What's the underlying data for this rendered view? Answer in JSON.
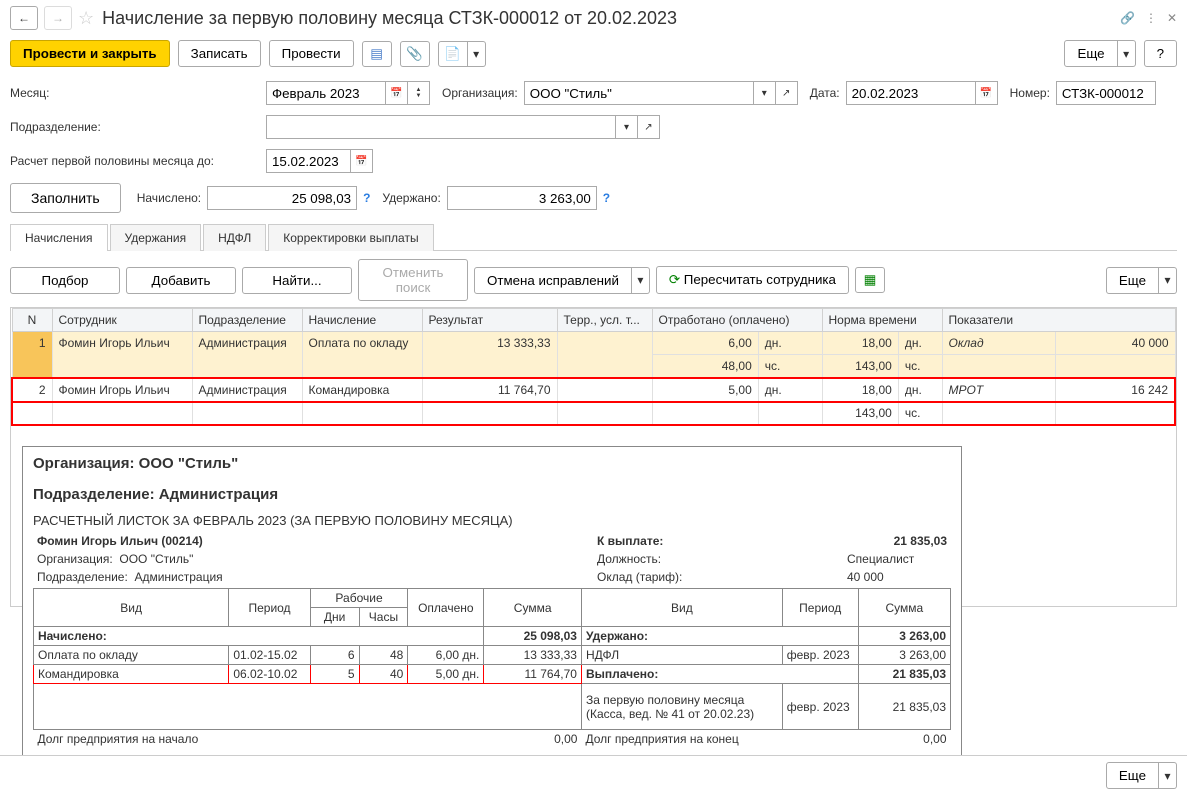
{
  "header": {
    "title": "Начисление за первую половину месяца СТЗК-000012 от 20.02.2023"
  },
  "toolbar": {
    "submit_close": "Провести и закрыть",
    "write": "Записать",
    "submit": "Провести",
    "more": "Еще",
    "help": "?"
  },
  "form": {
    "month_label": "Месяц:",
    "month_value": "Февраль 2023",
    "org_label": "Организация:",
    "org_value": "ООО \"Стиль\"",
    "date_label": "Дата:",
    "date_value": "20.02.2023",
    "number_label": "Номер:",
    "number_value": "СТЗК-000012",
    "dept_label": "Подразделение:",
    "dept_value": "",
    "calc_label": "Расчет первой половины месяца до:",
    "calc_value": "15.02.2023",
    "fill_btn": "Заполнить",
    "accrued_label": "Начислено:",
    "accrued_value": "25 098,03",
    "withheld_label": "Удержано:",
    "withheld_value": "3 263,00"
  },
  "tabs": {
    "t1": "Начисления",
    "t2": "Удержания",
    "t3": "НДФЛ",
    "t4": "Корректировки выплаты"
  },
  "grid_toolbar": {
    "select": "Подбор",
    "add": "Добавить",
    "find": "Найти...",
    "cancel_search": "Отменить поиск",
    "cancel_fix": "Отмена исправлений",
    "recalc": "Пересчитать сотрудника",
    "more": "Еще"
  },
  "grid": {
    "headers": {
      "n": "N",
      "emp": "Сотрудник",
      "dept": "Подразделение",
      "accr": "Начисление",
      "result": "Результат",
      "terr": "Терр., усл. т...",
      "worked": "Отработано (оплачено)",
      "norm": "Норма времени",
      "ind": "Показатели"
    },
    "rows": [
      {
        "n": "1",
        "emp": "Фомин Игорь Ильич",
        "dept": "Администрация",
        "accr": "Оплата по окладу",
        "result": "13 333,33",
        "worked_d": "6,00",
        "worked_du": "дн.",
        "worked_h": "48,00",
        "worked_hu": "чс.",
        "norm_d": "18,00",
        "norm_du": "дн.",
        "norm_h": "143,00",
        "norm_hu": "чс.",
        "ind": "Оклад",
        "ind_val": "40 000"
      },
      {
        "n": "2",
        "emp": "Фомин Игорь Ильич",
        "dept": "Администрация",
        "accr": "Командировка",
        "result": "11 764,70",
        "worked_d": "5,00",
        "worked_du": "дн.",
        "worked_h": "",
        "worked_hu": "",
        "norm_d": "18,00",
        "norm_du": "дн.",
        "norm_h": "143,00",
        "norm_hu": "чс.",
        "ind": "МРОТ",
        "ind_val": "16 242"
      }
    ]
  },
  "payslip": {
    "org_line": "Организация: ООО \"Стиль\"",
    "dept_line": "Подразделение: Администрация",
    "title": "РАСЧЕТНЫЙ ЛИСТОК ЗА ФЕВРАЛЬ 2023 (ЗА ПЕРВУЮ ПОЛОВИНУ МЕСЯЦА)",
    "emp": "Фомин Игорь Ильич (00214)",
    "topay_label": "К выплате:",
    "topay_value": "21 835,03",
    "left_org_label": "Организация:",
    "left_org_value": "ООО \"Стиль\"",
    "left_dept_label": "Подразделение:",
    "left_dept_value": "Администрация",
    "pos_label": "Должность:",
    "pos_value": "Специалист",
    "sal_label": "Оклад (тариф):",
    "sal_value": "40 000",
    "h_vid": "Вид",
    "h_period": "Период",
    "h_work": "Рабочие",
    "h_days": "Дни",
    "h_hours": "Часы",
    "h_paid": "Оплачено",
    "h_sum": "Сумма",
    "accrued_label": "Начислено:",
    "accrued_total": "25 098,03",
    "withheld_label": "Удержано:",
    "withheld_total": "3 263,00",
    "line1_name": "Оплата по окладу",
    "line1_period": "01.02-15.02",
    "line1_d": "6",
    "line1_h": "48",
    "line1_paid": "6,00 дн.",
    "line1_sum": "13 333,33",
    "line2_name": "Командировка",
    "line2_period": "06.02-10.02",
    "line2_d": "5",
    "line2_h": "40",
    "line2_paid": "5,00 дн.",
    "line2_sum": "11 764,70",
    "ndfl_name": "НДФЛ",
    "ndfl_period": "февр. 2023",
    "ndfl_sum": "3 263,00",
    "paid_label": "Выплачено:",
    "paid_total": "21 835,03",
    "paid_line_name": "За первую половину месяца (Касса, вед. № 41 от 20.02.23)",
    "paid_line_period": "февр. 2023",
    "paid_line_sum": "21 835,03",
    "debt_start": "Долг предприятия на начало",
    "debt_start_val": "0,00",
    "debt_end": "Долг предприятия на конец",
    "debt_end_val": "0,00"
  },
  "footer": {
    "more": "Еще"
  }
}
